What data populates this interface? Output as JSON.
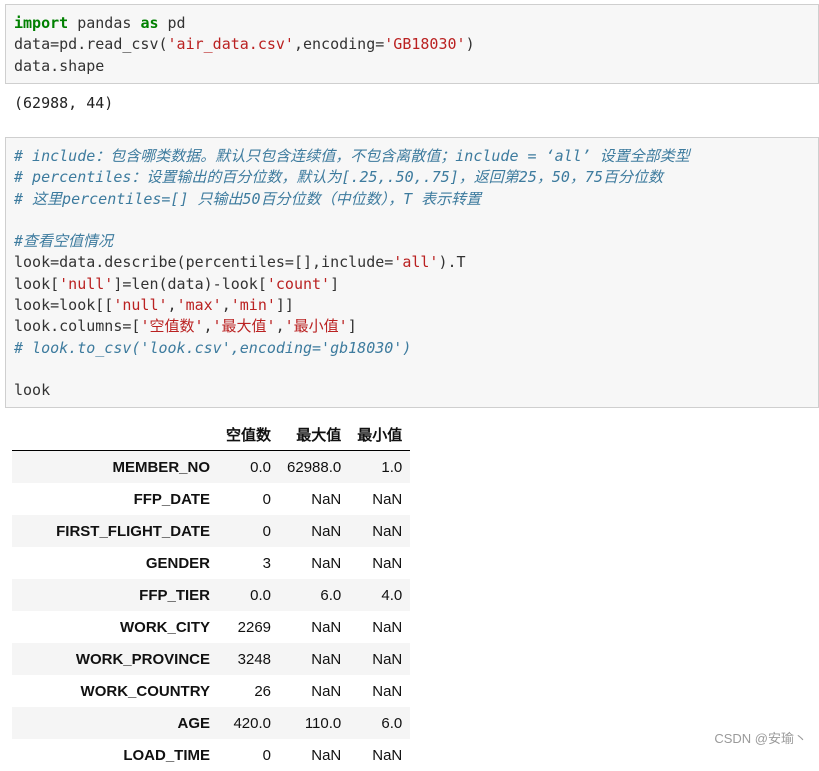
{
  "cell1": {
    "lines": [
      [
        {
          "t": "import",
          "c": "kw"
        },
        {
          "t": " pandas ",
          "c": ""
        },
        {
          "t": "as",
          "c": "kw"
        },
        {
          "t": " pd",
          "c": ""
        }
      ],
      [
        {
          "t": "data=pd.read_csv(",
          "c": ""
        },
        {
          "t": "'air_data.csv'",
          "c": "str"
        },
        {
          "t": ",encoding=",
          "c": ""
        },
        {
          "t": "'GB18030'",
          "c": "str"
        },
        {
          "t": ")",
          "c": ""
        }
      ],
      [
        {
          "t": "data.shape",
          "c": ""
        }
      ]
    ]
  },
  "output1": "(62988, 44)",
  "cell2": {
    "lines": [
      [
        {
          "t": "# include：包含哪类数据。默认只包含连续值，不包含离散值；include = ‘all’ 设置全部类型",
          "c": "cm"
        }
      ],
      [
        {
          "t": "# percentiles：设置输出的百分位数，默认为[.25,.50,.75]，返回第25，50，75百分位数",
          "c": "cm"
        }
      ],
      [
        {
          "t": "# 这里percentiles=[] 只输出50百分位数（中位数），T 表示转置",
          "c": "cm"
        }
      ],
      [],
      [
        {
          "t": "#查看空值情况",
          "c": "cm"
        }
      ],
      [
        {
          "t": "look=data.describe(percentiles=[],include=",
          "c": ""
        },
        {
          "t": "'all'",
          "c": "str"
        },
        {
          "t": ").T",
          "c": ""
        }
      ],
      [
        {
          "t": "look[",
          "c": ""
        },
        {
          "t": "'null'",
          "c": "str"
        },
        {
          "t": "]=len(data)-look[",
          "c": ""
        },
        {
          "t": "'count'",
          "c": "str"
        },
        {
          "t": "]",
          "c": ""
        }
      ],
      [
        {
          "t": "look=look[[",
          "c": ""
        },
        {
          "t": "'null'",
          "c": "str"
        },
        {
          "t": ",",
          "c": ""
        },
        {
          "t": "'max'",
          "c": "str"
        },
        {
          "t": ",",
          "c": ""
        },
        {
          "t": "'min'",
          "c": "str"
        },
        {
          "t": "]]",
          "c": ""
        }
      ],
      [
        {
          "t": "look.columns=[",
          "c": ""
        },
        {
          "t": "'空值数'",
          "c": "str"
        },
        {
          "t": ",",
          "c": ""
        },
        {
          "t": "'最大值'",
          "c": "str"
        },
        {
          "t": ",",
          "c": ""
        },
        {
          "t": "'最小值'",
          "c": "str"
        },
        {
          "t": "]",
          "c": ""
        }
      ],
      [
        {
          "t": "# look.to_csv('look.csv',encoding='gb18030')",
          "c": "cm"
        }
      ],
      [],
      [
        {
          "t": "look",
          "c": ""
        }
      ]
    ]
  },
  "table": {
    "columns": [
      "",
      "空值数",
      "最大值",
      "最小值"
    ],
    "rows": [
      [
        "MEMBER_NO",
        "0.0",
        "62988.0",
        "1.0"
      ],
      [
        "FFP_DATE",
        "0",
        "NaN",
        "NaN"
      ],
      [
        "FIRST_FLIGHT_DATE",
        "0",
        "NaN",
        "NaN"
      ],
      [
        "GENDER",
        "3",
        "NaN",
        "NaN"
      ],
      [
        "FFP_TIER",
        "0.0",
        "6.0",
        "4.0"
      ],
      [
        "WORK_CITY",
        "2269",
        "NaN",
        "NaN"
      ],
      [
        "WORK_PROVINCE",
        "3248",
        "NaN",
        "NaN"
      ],
      [
        "WORK_COUNTRY",
        "26",
        "NaN",
        "NaN"
      ],
      [
        "AGE",
        "420.0",
        "110.0",
        "6.0"
      ],
      [
        "LOAD_TIME",
        "0",
        "NaN",
        "NaN"
      ]
    ]
  },
  "watermark": "CSDN @安瑜丶"
}
